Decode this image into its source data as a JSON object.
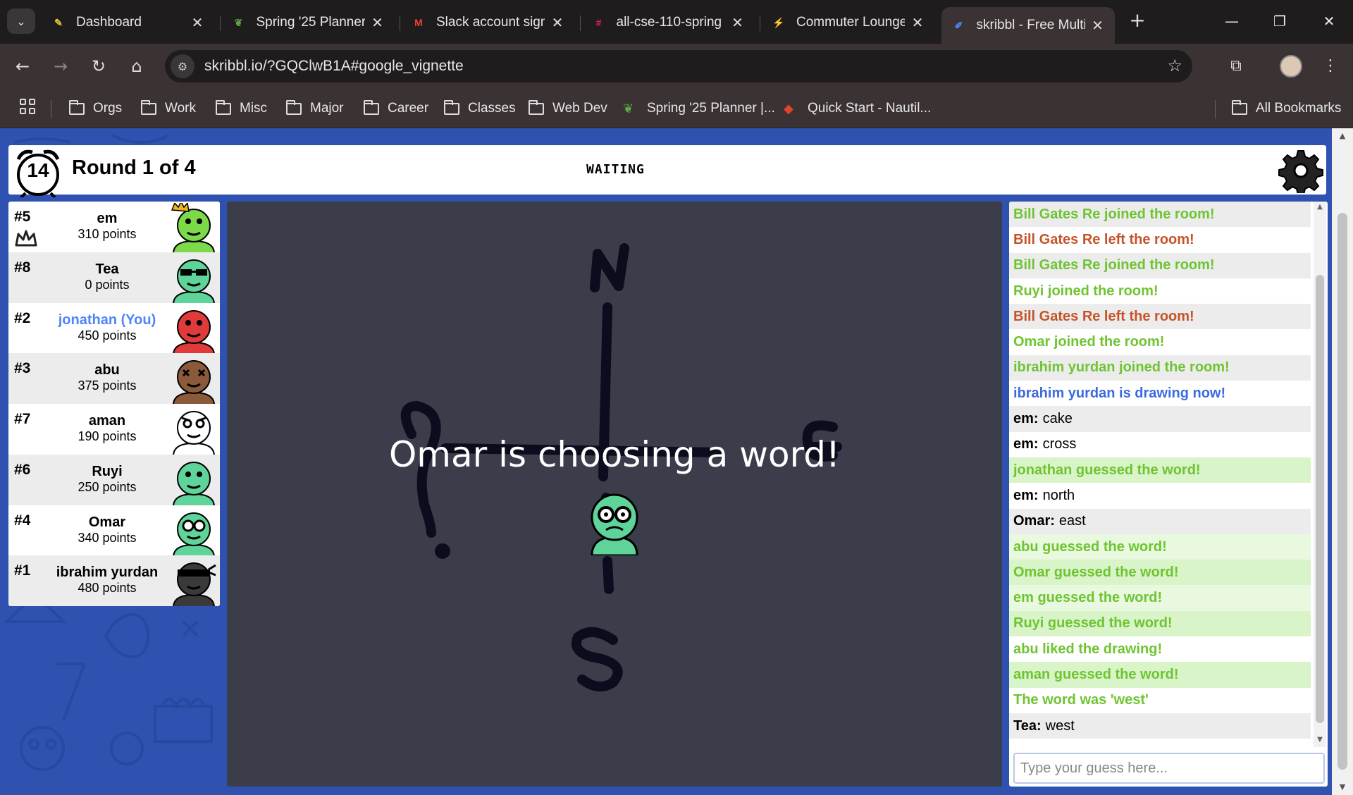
{
  "browser": {
    "tabs": [
      {
        "title": "Dashboard",
        "icon": "canvas-icon",
        "color": "#e6c63a"
      },
      {
        "title": "Spring '25 Planner",
        "icon": "sprout-icon",
        "color": "#5aa846"
      },
      {
        "title": "Slack account sign",
        "icon": "gmail-icon",
        "color": "#ea4335"
      },
      {
        "title": "all-cse-110-spring",
        "icon": "slack-icon",
        "color": "#e01e5a"
      },
      {
        "title": "Commuter Lounge",
        "icon": "bolt-icon",
        "color": "#e6c63a"
      },
      {
        "title": "skribbl - Free Multi",
        "icon": "pencil-icon",
        "color": "#4f86f7"
      }
    ],
    "url": "skribbl.io/?GQClwB1A#google_vignette",
    "bookmarks": [
      {
        "label": "Orgs",
        "type": "folder"
      },
      {
        "label": "Work",
        "type": "folder"
      },
      {
        "label": "Misc",
        "type": "folder"
      },
      {
        "label": "Major",
        "type": "folder"
      },
      {
        "label": "Career",
        "type": "folder"
      },
      {
        "label": "Classes",
        "type": "folder"
      },
      {
        "label": "Web Dev",
        "type": "folder"
      },
      {
        "label": "Spring '25 Planner |...",
        "type": "link"
      },
      {
        "label": "Quick Start - Nautil...",
        "type": "link"
      }
    ],
    "all_bookmarks": "All Bookmarks"
  },
  "game": {
    "timer": "14",
    "round": "Round 1 of 4",
    "status": "WAITING",
    "overlay": "Omar is choosing a word!",
    "compass_letters": [
      "N",
      "S"
    ],
    "players": [
      {
        "rank": "#5",
        "name": "em",
        "points": "310 points",
        "color": "#7bd94a",
        "owner": true,
        "me": false
      },
      {
        "rank": "#8",
        "name": "Tea",
        "points": "0 points",
        "color": "#5fd49a",
        "owner": false,
        "me": false
      },
      {
        "rank": "#2",
        "name": "jonathan (You)",
        "points": "450 points",
        "color": "#e03a3a",
        "owner": false,
        "me": true
      },
      {
        "rank": "#3",
        "name": "abu",
        "points": "375 points",
        "color": "#8a5a3a",
        "owner": false,
        "me": false
      },
      {
        "rank": "#7",
        "name": "aman",
        "points": "190 points",
        "color": "#ffffff",
        "owner": false,
        "me": false
      },
      {
        "rank": "#6",
        "name": "Ruyi",
        "points": "250 points",
        "color": "#5fd49a",
        "owner": false,
        "me": false
      },
      {
        "rank": "#4",
        "name": "Omar",
        "points": "340 points",
        "color": "#5fd49a",
        "owner": false,
        "me": false
      },
      {
        "rank": "#1",
        "name": "ibrahim yurdan",
        "points": "480 points",
        "color": "#3a3a3a",
        "owner": false,
        "me": false
      }
    ],
    "chat": [
      {
        "type": "green",
        "text": "Bill Gates Re joined the room!"
      },
      {
        "type": "red",
        "text": "Bill Gates Re left the room!"
      },
      {
        "type": "green",
        "text": "Bill Gates Re joined the room!"
      },
      {
        "type": "green",
        "text": "Ruyi joined the room!"
      },
      {
        "type": "red",
        "text": "Bill Gates Re left the room!"
      },
      {
        "type": "green",
        "text": "Omar joined the room!"
      },
      {
        "type": "green",
        "text": "ibrahim yurdan joined the room!"
      },
      {
        "type": "blue",
        "text": "ibrahim yurdan is drawing now!"
      },
      {
        "type": "msg",
        "who": "em:",
        "text": "cake"
      },
      {
        "type": "msg",
        "who": "em:",
        "text": "cross"
      },
      {
        "type": "guessed",
        "text": "jonathan guessed the word!"
      },
      {
        "type": "msg",
        "who": "em:",
        "text": "north"
      },
      {
        "type": "msg",
        "who": "Omar:",
        "text": "east"
      },
      {
        "type": "guessed",
        "text": "abu guessed the word!"
      },
      {
        "type": "guessed",
        "text": "Omar guessed the word!"
      },
      {
        "type": "guessed",
        "text": "em guessed the word!"
      },
      {
        "type": "guessed",
        "text": "Ruyi guessed the word!"
      },
      {
        "type": "green",
        "text": "abu liked the drawing!"
      },
      {
        "type": "guessed",
        "text": "aman guessed the word!"
      },
      {
        "type": "green",
        "text": "The word was 'west'"
      },
      {
        "type": "msg",
        "who": "Tea:",
        "text": "west"
      }
    ],
    "guess_placeholder": "Type your guess here..."
  }
}
